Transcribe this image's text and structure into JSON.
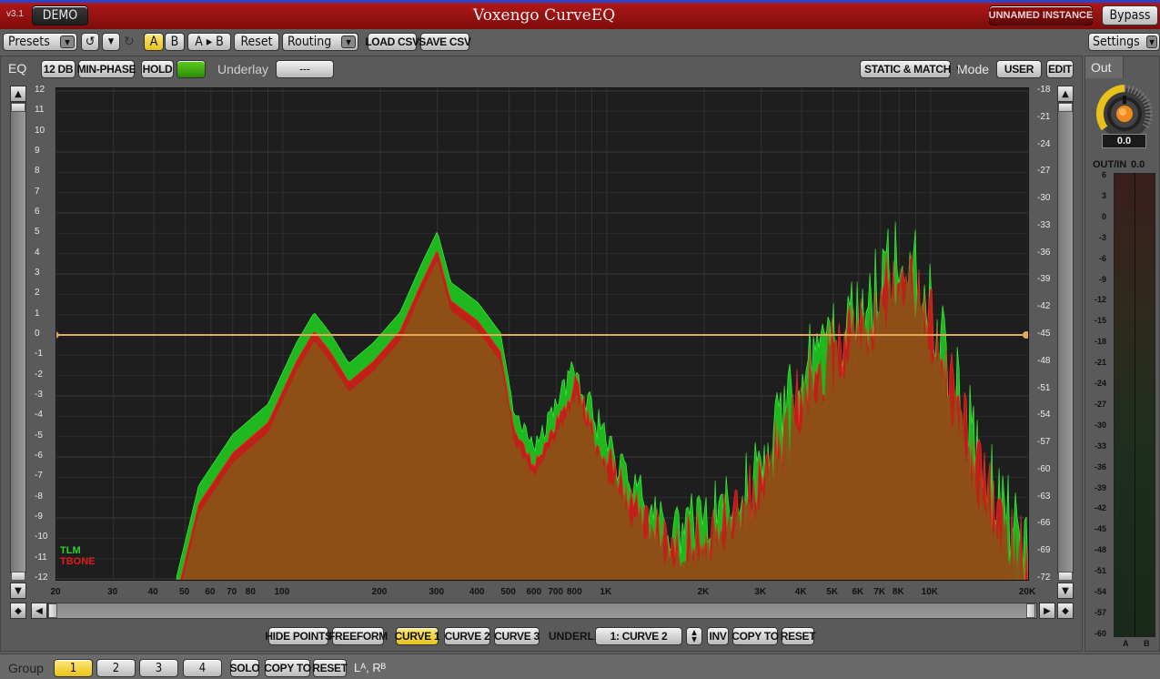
{
  "titlebar": {
    "version": "v3.1",
    "demo": "DEMO",
    "title": "Voxengo CurveEQ",
    "instance": "UNNAMED INSTANCE",
    "bypass": "Bypass"
  },
  "toolbar": {
    "presets": "Presets",
    "a": "A",
    "b": "B",
    "atob": "A ▸ B",
    "reset": "Reset",
    "routing": "Routing",
    "load_csv": "LOAD CSV",
    "save_csv": "SAVE CSV",
    "settings": "Settings"
  },
  "eq_bar": {
    "eq_label": "EQ",
    "db": "12 DB",
    "min_phase": "MIN-PHASE",
    "hold": "HOLD",
    "underlay_label": "Underlay",
    "underlay_value": "---",
    "static_match": "STATIC & MATCH",
    "mode_label": "Mode",
    "mode_value": "USER",
    "edit": "EDIT"
  },
  "out": {
    "label": "Out",
    "knob_value": "0.0",
    "outin_label": "OUT/IN",
    "outin_value": "0.0",
    "meter_ticks": [
      "6",
      "3",
      "0",
      "-3",
      "-6",
      "-9",
      "-12",
      "-15",
      "-18",
      "-21",
      "-24",
      "-27",
      "-30",
      "-33",
      "-36",
      "-39",
      "-42",
      "-45",
      "-48",
      "-51",
      "-54",
      "-57",
      "-60"
    ],
    "channels": [
      "A",
      "B"
    ]
  },
  "graph": {
    "left_ticks": [
      "12",
      "11",
      "10",
      "9",
      "8",
      "7",
      "6",
      "5",
      "4",
      "3",
      "2",
      "1",
      "0",
      "-1",
      "-2",
      "-3",
      "-4",
      "-5",
      "-6",
      "-7",
      "-8",
      "-9",
      "-10",
      "-11",
      "-12"
    ],
    "right_ticks": [
      "-18",
      "-21",
      "-24",
      "-27",
      "-30",
      "-33",
      "-36",
      "-39",
      "-42",
      "-45",
      "-48",
      "-51",
      "-54",
      "-57",
      "-60",
      "-63",
      "-66",
      "-69",
      "-72"
    ],
    "freq_ticks": [
      "20",
      "30",
      "40",
      "50",
      "60",
      "70",
      "80",
      "100",
      "200",
      "300",
      "400",
      "500",
      "600",
      "700",
      "800",
      "1K",
      "2K",
      "3K",
      "4K",
      "5K",
      "6K",
      "7K",
      "8K",
      "10K",
      "20K"
    ],
    "legend": [
      {
        "name": "TLM",
        "color": "#2fd12f"
      },
      {
        "name": "TBONE",
        "color": "#e01c1c"
      }
    ],
    "curve_color": "#e6a85a"
  },
  "bottom": {
    "hide_points": "HIDE POINTS",
    "freeform": "FREEFORM",
    "curve1": "CURVE 1",
    "curve2": "CURVE 2",
    "curve3": "CURVE 3",
    "underlay_label": "UNDERLAY",
    "underlay_value": "1: CURVE 2",
    "inv": "INV",
    "copy_to": "COPY TO",
    "reset": "RESET"
  },
  "group": {
    "label": "Group",
    "items": [
      "1",
      "2",
      "3",
      "4"
    ],
    "solo": "SOLO",
    "copy_to": "COPY TO",
    "reset": "RESET",
    "channels": "Lᴬ, Rᴮ"
  }
}
